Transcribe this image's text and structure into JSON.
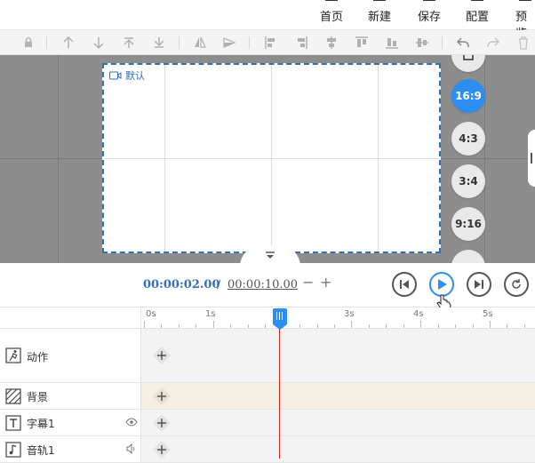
{
  "menu": {
    "home": "首页",
    "new": "新建",
    "save": "保存",
    "config": "配置",
    "preview": "预览"
  },
  "toolbar_icons": [
    "lock-icon",
    "move-up-icon",
    "move-down-icon",
    "move-top-icon",
    "move-bottom-icon",
    "flip-horizontal-icon",
    "flip-vertical-icon",
    "align-left-icon",
    "align-right-icon",
    "align-center-icon",
    "align-top-icon",
    "align-middle-icon",
    "align-bottom-icon",
    "undo-icon",
    "redo-icon",
    "delete-icon"
  ],
  "canvas": {
    "label": "默认"
  },
  "ratios": {
    "r169": "16:9",
    "r43": "4:3",
    "r34": "3:4",
    "r916": "9:16"
  },
  "playback": {
    "current_time": "00:00:02.00",
    "separator": "/",
    "total_time": "00:00:10.00",
    "minus": "−",
    "plus": "+"
  },
  "ruler": {
    "ticks": [
      "0s",
      "1s",
      "3s",
      "4s",
      "5s"
    ]
  },
  "tracks": {
    "action": "动作",
    "background": "背景",
    "subtitle": "字幕1",
    "audio": "音轨1"
  },
  "colors": {
    "accent": "#2b8ef0",
    "playhead": "#e02020",
    "time_blue": "#2f6fb8"
  }
}
